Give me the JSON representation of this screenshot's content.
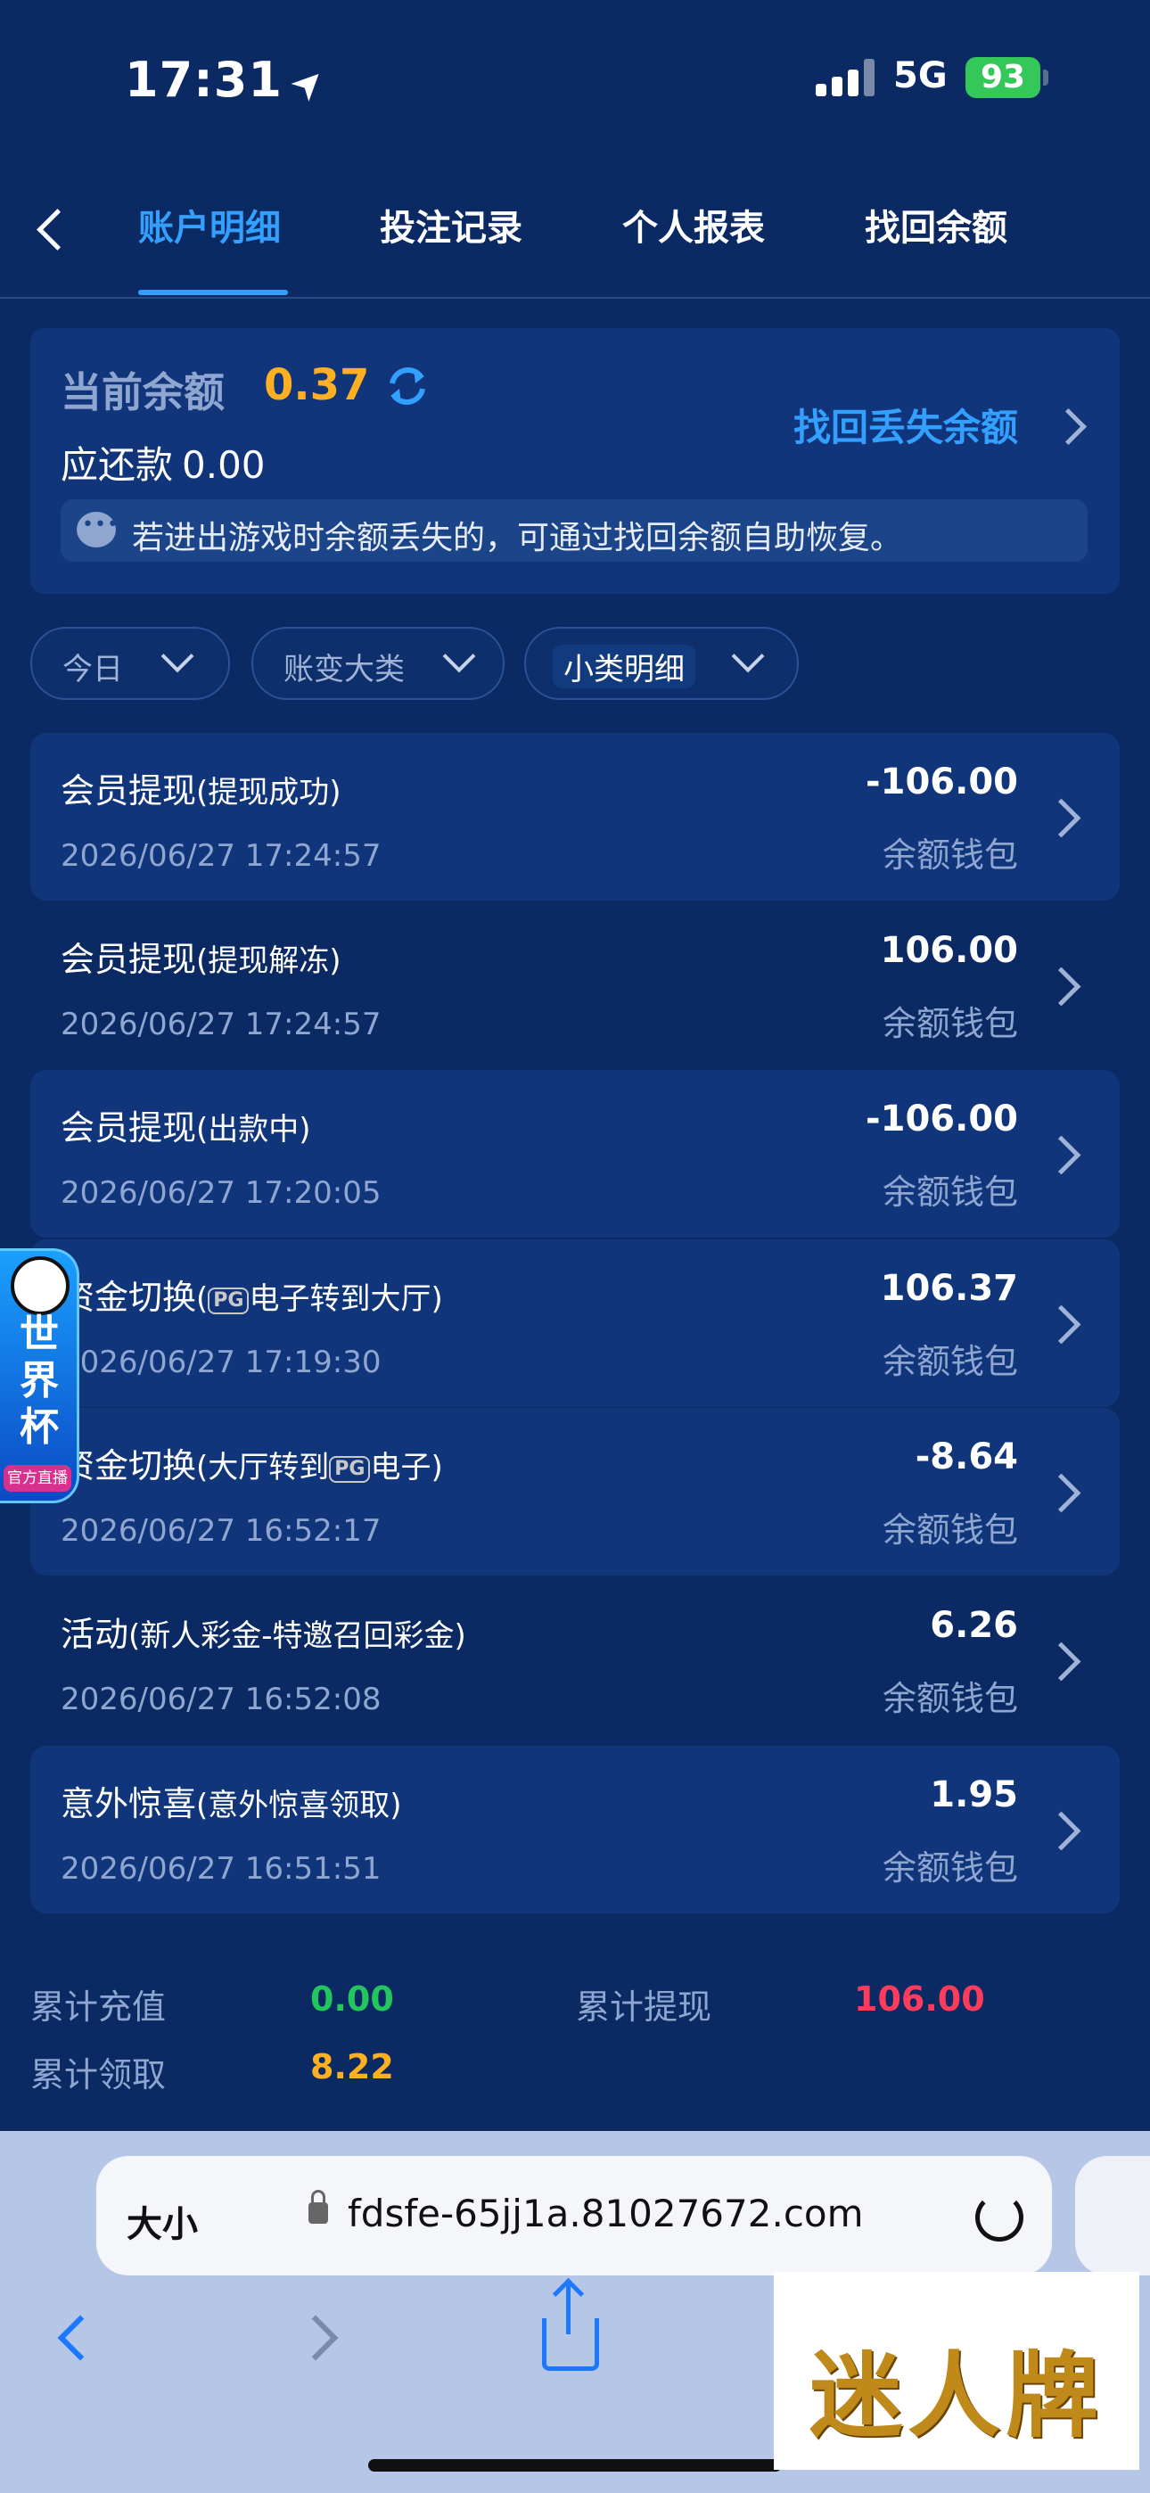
{
  "status_bar": {
    "time": "17:31",
    "network": "5G",
    "battery": "93"
  },
  "nav": {
    "tabs": [
      {
        "label": "账户明细",
        "active": true
      },
      {
        "label": "投注记录",
        "active": false
      },
      {
        "label": "个人报表",
        "active": false
      },
      {
        "label": "找回余额",
        "active": false
      }
    ]
  },
  "balance": {
    "label": "当前余额",
    "value": "0.37",
    "owe_label": "应还款",
    "owe_value": "0.00",
    "recover_link": "找回丢失余额",
    "notice": "若进出游戏时余额丢失的，可通过找回余额自助恢复。"
  },
  "filters": [
    "今日",
    "账变大类",
    "小类明细"
  ],
  "transactions": [
    {
      "title": "会员提现",
      "detail": "(提现成功)",
      "date": "2026/06/27 17:24:57",
      "amount": "-106.00",
      "wallet": "余额钱包"
    },
    {
      "title": "会员提现",
      "detail": "(提现解冻)",
      "date": "2026/06/27 17:24:57",
      "amount": "106.00",
      "wallet": "余额钱包"
    },
    {
      "title": "会员提现",
      "detail": "(出款中)",
      "date": "2026/06/27 17:20:05",
      "amount": "-106.00",
      "wallet": "余额钱包"
    },
    {
      "title": "资金切换",
      "detail_pre": "(",
      "pg": "PG",
      "detail_post": "电子转到大厅)",
      "date": "2026/06/27 17:19:30",
      "amount": "106.37",
      "wallet": "余额钱包"
    },
    {
      "title": "资金切换",
      "detail_pre": "(大厅转到",
      "pg": "PG",
      "detail_post": "电子)",
      "date": "2026/06/27 16:52:17",
      "amount": "-8.64",
      "wallet": "余额钱包"
    },
    {
      "title": "活动",
      "detail": "(新人彩金-特邀召回彩金)",
      "date": "2026/06/27 16:52:08",
      "amount": "6.26",
      "wallet": "余额钱包"
    },
    {
      "title": "意外惊喜",
      "detail": "(意外惊喜领取)",
      "date": "2026/06/27 16:51:51",
      "amount": "1.95",
      "wallet": "余额钱包"
    }
  ],
  "totals": {
    "recharge_label": "累计充值",
    "recharge_value": "0.00",
    "withdraw_label": "累计提现",
    "withdraw_value": "106.00",
    "claim_label": "累计领取",
    "claim_value": "8.22"
  },
  "colors": {
    "accent": "#33a0ff",
    "balance": "#ffb020",
    "recharge": "#22c55e",
    "withdraw": "#ff3b5c",
    "claim": "#ffb020"
  },
  "world_cup": {
    "text": "世界杯",
    "badge": "官方直播"
  },
  "browser": {
    "text_size": "大小",
    "url": "fdsfe-65jj1a.81027672.com"
  },
  "watermark": "迷人牌"
}
